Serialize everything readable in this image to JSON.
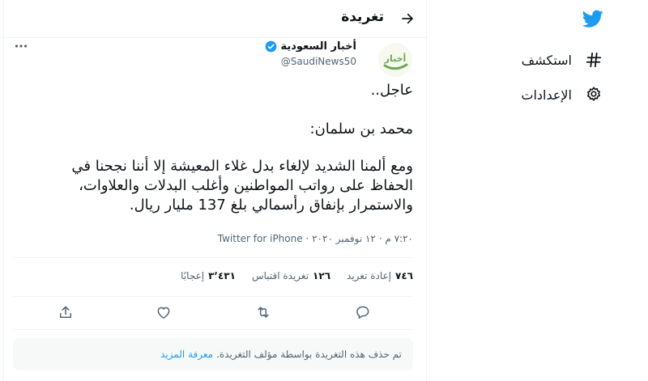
{
  "colors": {
    "brand": "#1d9bf0",
    "text": "#0f1419",
    "muted": "#536471",
    "divider": "#eff3f4"
  },
  "nav": {
    "logo_icon": "twitter-bird-icon",
    "items": [
      {
        "label": "استكشف",
        "icon": "hashtag-icon"
      },
      {
        "label": "الإعدادات",
        "icon": "gear-icon"
      }
    ]
  },
  "header": {
    "title": "تغريدة",
    "back_icon": "arrow-back-icon"
  },
  "tweet": {
    "author": {
      "name": "أخبار السعودية",
      "handle": "@SaudiNews50",
      "verified": true,
      "avatar_text": "أخبار"
    },
    "lines": [
      "عاجل..",
      "محمد بن سلمان:",
      "ومع ألمنا الشديد لإلغاء بدل غلاء المعيشة إلا أننا نجحنا في",
      "الحفاظ على رواتب المواطنين وأغلب البدلات والعلاوات،",
      "والاستمرار بإنفاق رأسمالي بلغ 137 مليار ريال."
    ],
    "time": "٧:٢٠ م",
    "date": "١٢ نوفمبر ٢٠٢٠",
    "separator": "·",
    "source": "Twitter for iPhone",
    "stats": [
      {
        "count": "٧٤٦",
        "label": "إعادة تغريد"
      },
      {
        "count": "١٢٦",
        "label": "تغريدة اقتباس"
      },
      {
        "count": "٣٬٤٣١",
        "label": "إعجابًا"
      }
    ],
    "actions": [
      "reply-icon",
      "retweet-icon",
      "like-icon",
      "share-icon"
    ]
  },
  "notice": {
    "text": "تم حذف هذه التغريدة بواسطة مؤلف التغريدة.",
    "link": "معرفة المزيد"
  }
}
